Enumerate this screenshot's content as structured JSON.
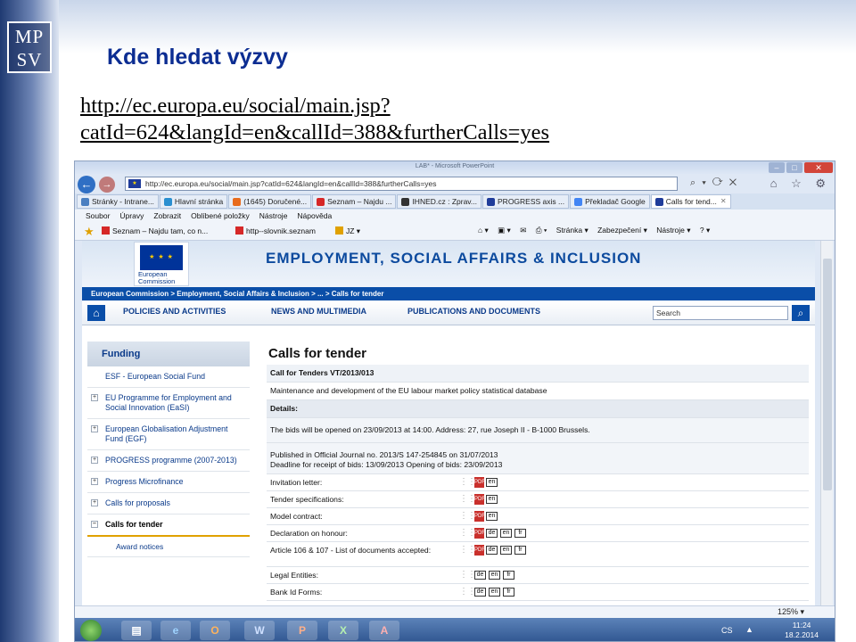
{
  "slide": {
    "logo_line1": "MP",
    "logo_line2": "SV",
    "title": "Kde hledat výzvy",
    "url": "http://ec.europa.eu/social/main.jsp?catId=624&langId=en&callId=388&furtherCalls=yes"
  },
  "window": {
    "title": "LAB* - Microsoft PowerPoint",
    "close": "✕",
    "min": "–",
    "max": "□"
  },
  "address": {
    "url": "http://ec.europa.eu/social/main.jsp?catId=624&langId=en&callId=388&furtherCalls=yes",
    "tools": "⌕ ▾ ⟳ ✕",
    "nav_icons": "⌂ ☆ ⚙"
  },
  "tabs": [
    {
      "label": "Stránky - Intrane...",
      "color": "#4a7fc1"
    },
    {
      "label": "Hlavní stránka",
      "color": "#2a8fd0"
    },
    {
      "label": "(1645) Doručené...",
      "color": "#e86c1e"
    },
    {
      "label": "Seznam – Najdu ...",
      "color": "#d62828"
    },
    {
      "label": "IHNED.cz : Zprav...",
      "color": "#333333"
    },
    {
      "label": "PROGRESS axis ...",
      "color": "#1f3c9a"
    },
    {
      "label": "Překladač Google",
      "color": "#4285f4"
    },
    {
      "label": "Calls for tend...",
      "color": "#1f3c9a"
    }
  ],
  "menu": [
    "Soubor",
    "Úpravy",
    "Zobrazit",
    "Oblíbené položky",
    "Nástroje",
    "Nápověda"
  ],
  "favorites": [
    {
      "label": "Seznam – Najdu tam, co n...",
      "color": "#d62828"
    },
    {
      "label": "http--slovnik.seznam",
      "color": "#d62828"
    },
    {
      "label": "JZ ▾",
      "color": "#e0a100"
    }
  ],
  "commandbar": [
    "⌂ ▾",
    "▣ ▾",
    "✉",
    "⎙ ▾",
    "Stránka ▾",
    "Zabezpečení ▾",
    "Nástroje ▾",
    "? ▾"
  ],
  "ec": {
    "flag": "★ ★ ★",
    "logo_text1": "European",
    "logo_text2": "Commission",
    "banner": "EMPLOYMENT, SOCIAL AFFAIRS & INCLUSION",
    "breadcrumb": "European Commission > Employment, Social Affairs & Inclusion > ... > Calls for tender",
    "home": "⌂",
    "nav": [
      "POLICIES AND ACTIVITIES",
      "NEWS AND MULTIMEDIA",
      "PUBLICATIONS AND DOCUMENTS"
    ],
    "search_value": "Search",
    "search_icon": "⌕"
  },
  "leftnav": {
    "heading": "Funding",
    "items": [
      {
        "label": "ESF - European Social Fund"
      },
      {
        "label": "EU Programme for Employment and Social Innovation (EaSI)"
      },
      {
        "label": "European Globalisation Adjustment Fund (EGF)"
      },
      {
        "label": "PROGRESS programme (2007-2013)"
      },
      {
        "label": "Progress Microfinance"
      },
      {
        "label": "Calls for proposals"
      },
      {
        "label": "Calls for tender"
      }
    ],
    "sub": "Award notices"
  },
  "main": {
    "title": "Calls for tender",
    "call_ref": "Call for Tenders VT/2013/013",
    "description": "Maintenance and development of the EU labour market policy statistical database",
    "details_label": "Details:",
    "opening": "The bids will be opened on 23/09/2013 at 14:00. Address: 27, rue Joseph II - B-1000 Brussels.",
    "published": "Published in Official Journal no. 2013/S 147-254845 on 31/07/2013",
    "deadline": "Deadline for receipt of bids: 13/09/2013 Opening of bids: 23/09/2013",
    "documents": [
      {
        "label": "Invitation letter:",
        "pdf": "PDF",
        "langs": [
          "en"
        ]
      },
      {
        "label": "Tender specifications:",
        "pdf": "PDF",
        "langs": [
          "en"
        ]
      },
      {
        "label": "Model contract:",
        "pdf": "PDF",
        "langs": [
          "en"
        ]
      },
      {
        "label": "Declaration on honour:",
        "pdf": "PDF",
        "langs": [
          "de",
          "en",
          "fr"
        ]
      },
      {
        "label": "Article 106 & 107 - List of documents accepted:",
        "pdf": "PDF",
        "langs": [
          "de",
          "en",
          "fr"
        ]
      },
      {
        "label": "Legal Entities:",
        "pdf": "",
        "langs": [
          "de",
          "en",
          "fr"
        ]
      },
      {
        "label": "Bank Id Forms:",
        "pdf": "",
        "langs": [
          "de",
          "en",
          "fr"
        ]
      }
    ]
  },
  "status": {
    "zoom": "125% ▾"
  },
  "taskbar": {
    "apps": [
      "▤",
      "e",
      "O",
      "W",
      "P",
      "X",
      "A"
    ],
    "lang": "CS",
    "arrow": "▲",
    "time": "11:24",
    "date": "18.2.2014"
  }
}
